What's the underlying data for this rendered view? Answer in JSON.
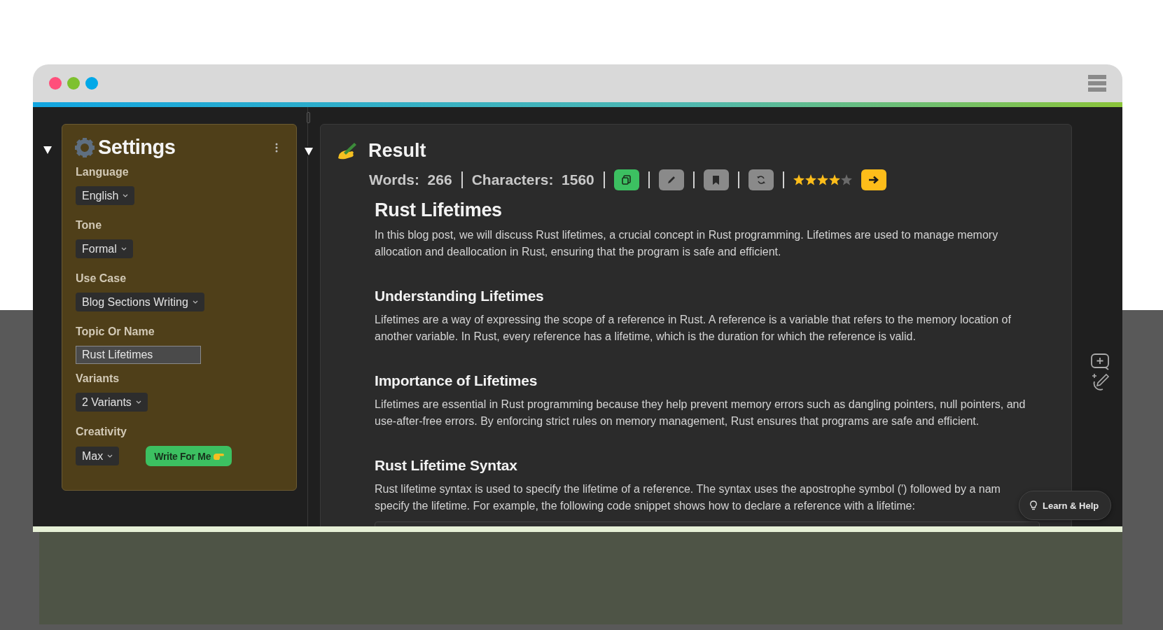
{
  "window": {
    "controls": [
      {
        "color": "#ff4f7b"
      },
      {
        "color": "#7ec12e"
      },
      {
        "color": "#00a8e8"
      }
    ]
  },
  "settings": {
    "title": "Settings",
    "fields": [
      {
        "kind": "select",
        "label": "Language",
        "value": "English"
      },
      {
        "kind": "select",
        "label": "Tone",
        "value": "Formal"
      },
      {
        "kind": "select",
        "label": "Use Case",
        "value": "Blog Sections Writing"
      },
      {
        "kind": "input",
        "label": "Topic Or Name",
        "value": "Rust Lifetimes"
      },
      {
        "kind": "select",
        "label": "Variants",
        "value": "2 Variants"
      },
      {
        "kind": "select",
        "label": "Creativity",
        "value": "Max"
      }
    ],
    "action": "Write For Me"
  },
  "result": {
    "title": "Result",
    "stats": [
      {
        "label": "Words:",
        "value": "266"
      },
      {
        "label": "Characters:",
        "value": "1560"
      }
    ],
    "actions": [
      {
        "kind": "copy"
      },
      {
        "kind": "edit"
      },
      {
        "kind": "bookmark"
      },
      {
        "kind": "refresh"
      }
    ],
    "stars": 4,
    "article": {
      "title": "Rust Lifetimes",
      "sections": [
        {
          "text": "In this blog post, we will discuss Rust lifetimes, a crucial concept in Rust programming. Lifetimes are used to manage memory allocation and deallocation in Rust, ensuring that the program is safe and efficient."
        },
        {
          "heading": "Understanding Lifetimes",
          "text": "Lifetimes are a way of expressing the scope of a reference in Rust. A reference is a variable that refers to the memory location of another variable. In Rust, every reference has a lifetime, which is the duration for which the reference is valid."
        },
        {
          "heading": "Importance of Lifetimes",
          "text": "Lifetimes are essential in Rust programming because they help prevent memory errors such as dangling pointers, null pointers, and use-after-free errors. By enforcing strict rules on memory management, Rust ensures that programs are safe and efficient."
        },
        {
          "heading": "Rust Lifetime Syntax",
          "lines": [
            "Rust lifetime syntax is used to specify the lifetime of a reference. The syntax uses the apostrophe symbol (') followed by a nam",
            "specify the lifetime. For example, the following code snippet shows how to declare a reference with a lifetime:"
          ]
        }
      ]
    }
  },
  "help": {
    "label": "Learn & Help"
  }
}
